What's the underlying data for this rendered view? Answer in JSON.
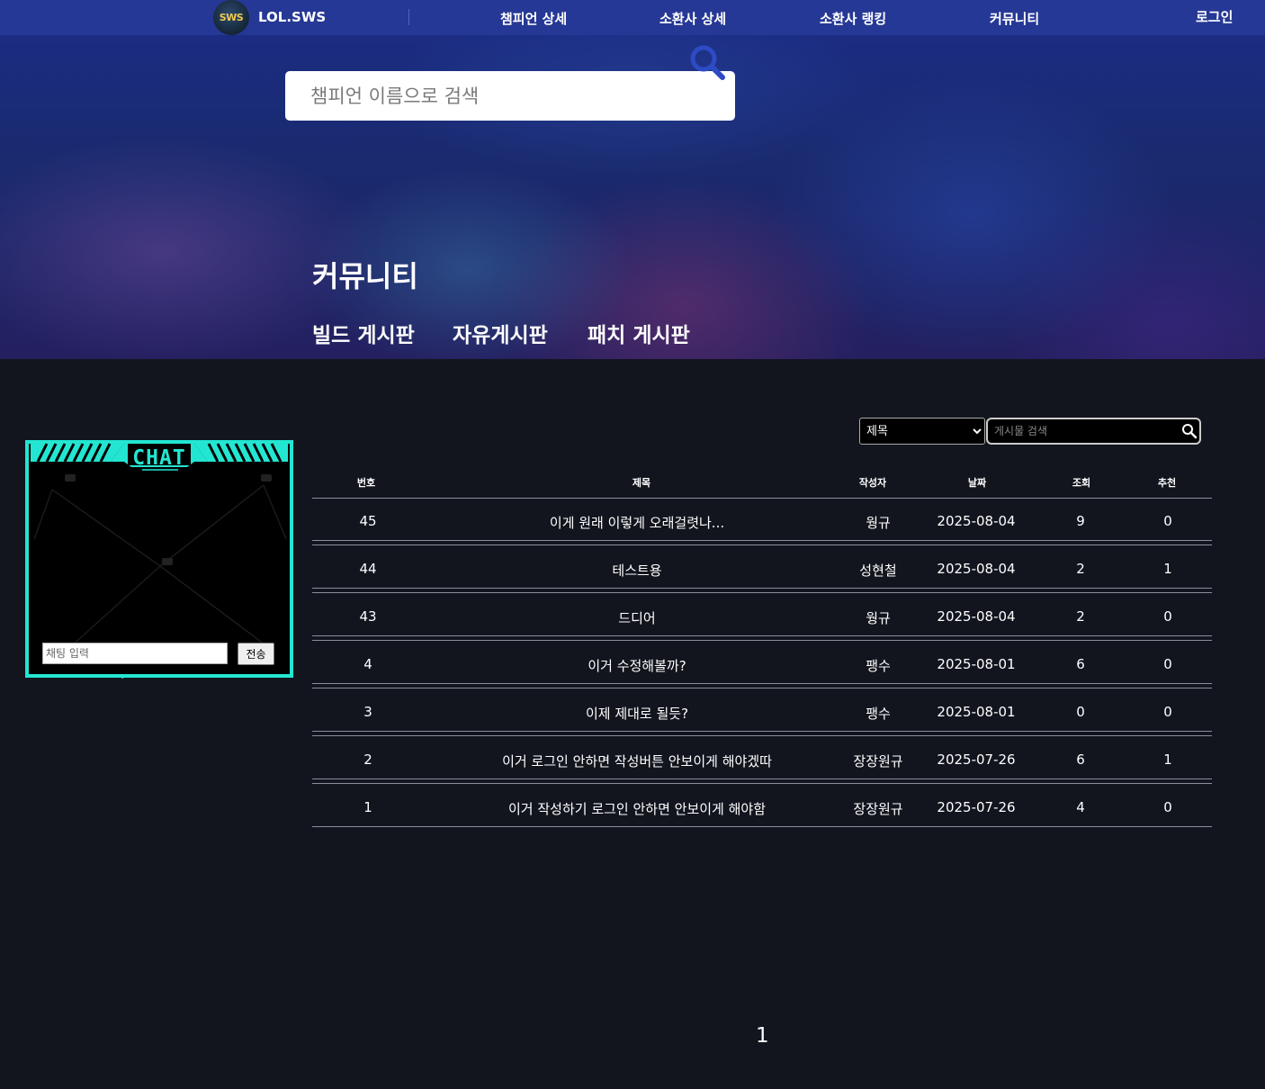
{
  "nav": {
    "logo_text": "SWS",
    "site_name": "LOL.SWS",
    "links": [
      "챔피언 상세",
      "소환사 상세",
      "소환사 랭킹",
      "커뮤니티"
    ],
    "login": "로그인"
  },
  "hero": {
    "search_placeholder": "챔피언 이름으로 검색",
    "search_icon": "magnifier-icon",
    "title": "커뮤니티",
    "tabs": [
      "빌드 게시판",
      "자유게시판",
      "패치 게시판"
    ]
  },
  "chat": {
    "title": "CHAT",
    "input_placeholder": "채팅 입력",
    "send_label": "전송",
    "accent_color": "#23e6d2"
  },
  "board": {
    "filter_selected": "제목",
    "search_placeholder": "게시물 검색",
    "columns": [
      "번호",
      "제목",
      "작성자",
      "날짜",
      "조회",
      "추천"
    ],
    "rows": [
      {
        "no": "45",
        "title": "이게 원래 이렇게 오래걸렷나...",
        "author": "웡규",
        "date": "2025-08-04",
        "views": "9",
        "likes": "0"
      },
      {
        "no": "44",
        "title": "테스트용",
        "author": "성현철",
        "date": "2025-08-04",
        "views": "2",
        "likes": "1"
      },
      {
        "no": "43",
        "title": "드디어",
        "author": "웡규",
        "date": "2025-08-04",
        "views": "2",
        "likes": "0"
      },
      {
        "no": "4",
        "title": "이거 수정해볼까?",
        "author": "팽수",
        "date": "2025-08-01",
        "views": "6",
        "likes": "0"
      },
      {
        "no": "3",
        "title": "이제 제대로 될듯?",
        "author": "팽수",
        "date": "2025-08-01",
        "views": "0",
        "likes": "0"
      },
      {
        "no": "2",
        "title": "이거 로그인 안하면 작성버튼 안보이게 해야겠따",
        "author": "장장원규",
        "date": "2025-07-26",
        "views": "6",
        "likes": "1"
      },
      {
        "no": "1",
        "title": "이거 작성하기 로그인 안하면 안보이게 해야함",
        "author": "장장원규",
        "date": "2025-07-26",
        "views": "4",
        "likes": "0"
      }
    ],
    "page": "1"
  },
  "colors": {
    "nav_bg": "#263895",
    "page_bg": "#12151e",
    "search_icon": "#2d4bc4"
  }
}
